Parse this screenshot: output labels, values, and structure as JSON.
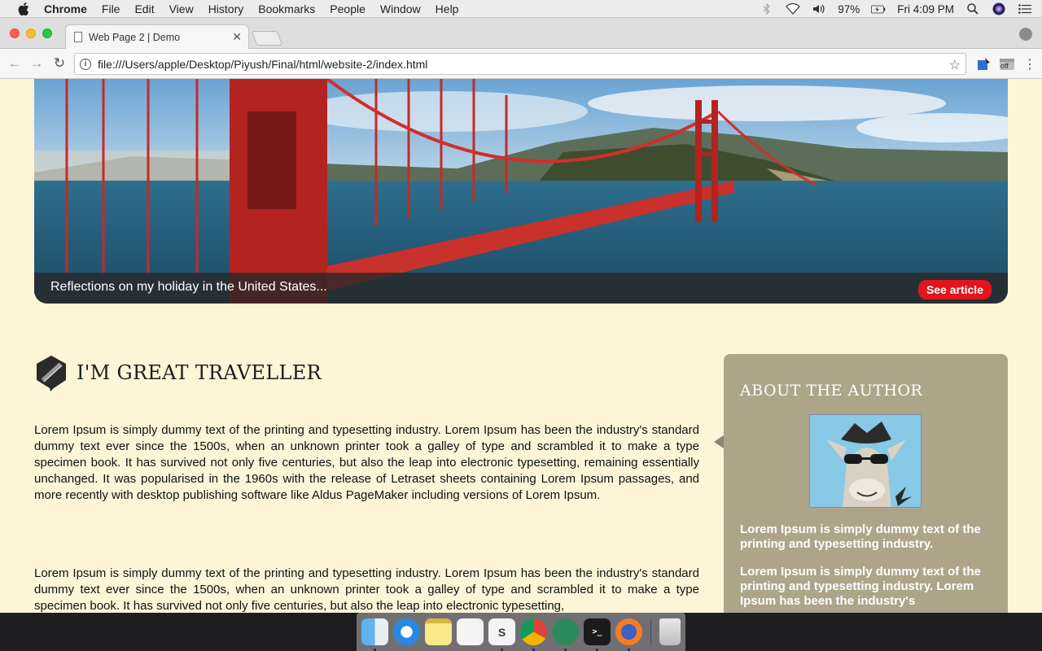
{
  "menubar": {
    "app_name": "Chrome",
    "items": [
      "File",
      "Edit",
      "View",
      "History",
      "Bookmarks",
      "People",
      "Window",
      "Help"
    ],
    "battery": "97%",
    "clock": "Fri 4:09 PM"
  },
  "browser": {
    "tab_title": "Web Page 2 | Demo",
    "url": "file:///Users/apple/Desktop/Piyush/Final/html/website-2/index.html",
    "extension_badge": "off"
  },
  "hero": {
    "caption": "Reflections on my holiday in the United States...",
    "button_label": "See article"
  },
  "main": {
    "heading": "I'M GREAT TRAVELLER",
    "paragraphs": [
      "Lorem Ipsum is simply dummy text of the printing and typesetting industry. Lorem Ipsum has been the industry's standard dummy text ever since the 1500s, when an unknown printer took a galley of type and scrambled it to make a type specimen book. It has survived not only five centuries, but also the leap into electronic typesetting, remaining essentially unchanged. It was popularised in the 1960s with the release of Letraset sheets containing Lorem Ipsum passages, and more recently with desktop publishing software like Aldus PageMaker including versions of Lorem Ipsum.",
      "Lorem Ipsum is simply dummy text of the printing and typesetting industry. Lorem Ipsum has been the industry's standard dummy text ever since the 1500s, when an unknown printer took a galley of type and scrambled it to make a type specimen book. It has survived not only five centuries, but also the leap into electronic typesetting,"
    ]
  },
  "sidebar": {
    "title": "ABOUT THE AUTHOR",
    "text1": "Lorem Ipsum is simply dummy text of the printing and typesetting industry.",
    "text2": "Lorem Ipsum is simply dummy text of the printing and typesetting industry. Lorem Ipsum has been the industry's"
  },
  "dock": {
    "items": [
      "finder-icon",
      "safari-icon",
      "notes-icon",
      "reminders-icon",
      "slack-icon",
      "chrome-icon",
      "atom-icon",
      "terminal-icon",
      "firefox-icon",
      "trash-icon"
    ]
  },
  "colors": {
    "page_background": "#fef5d6",
    "accent_red": "#e3141b",
    "sidebar_background": "#ada48a"
  }
}
